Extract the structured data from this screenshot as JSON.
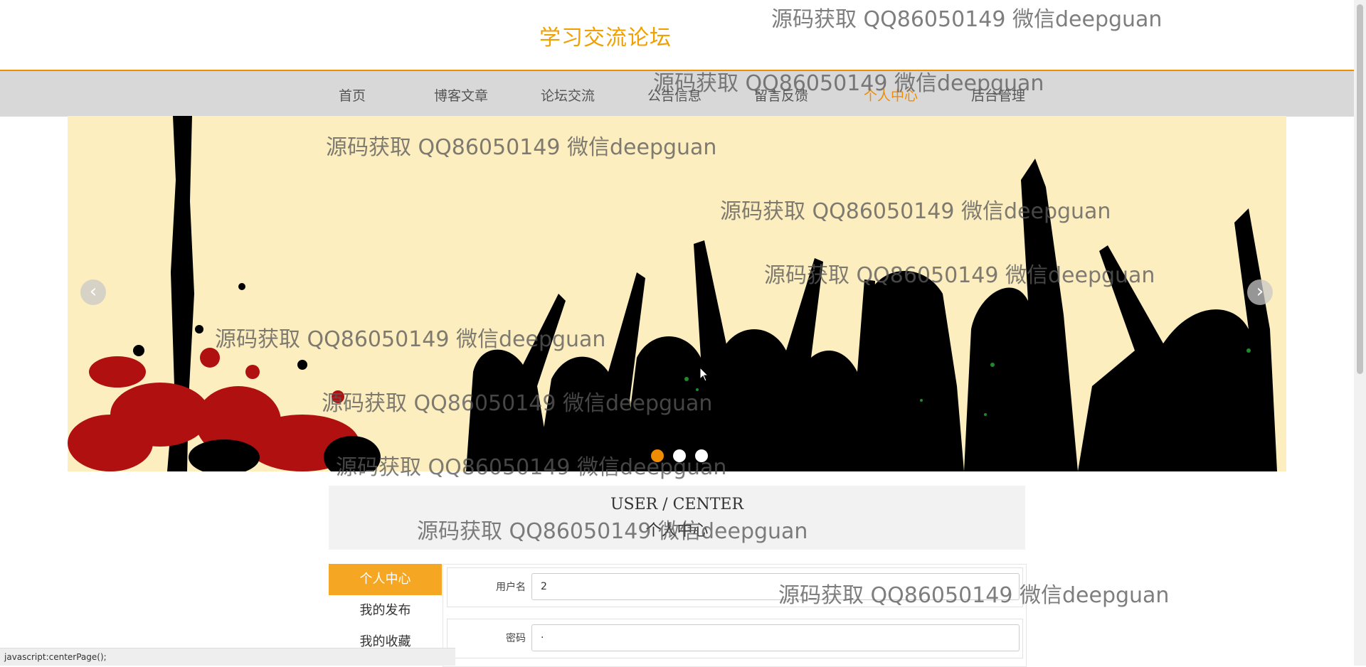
{
  "site_title": "学习交流论坛",
  "nav": {
    "items": [
      "首页",
      "博客文章",
      "论坛交流",
      "公告信息",
      "留言反馈",
      "个人中心",
      "后台管理"
    ],
    "active": "个人中心"
  },
  "banner": {
    "prev_icon": "chevron-left-icon",
    "next_icon": "chevron-right-icon",
    "prev_glyph": "‹",
    "next_glyph": "›",
    "slide_count": 3,
    "active_slide": 1
  },
  "section": {
    "title_en": "USER / CENTER",
    "title_cn": "个人中心"
  },
  "side_menu": {
    "items": [
      "个人中心",
      "我的发布",
      "我的收藏"
    ],
    "active": "个人中心"
  },
  "form": {
    "username_label": "用户名",
    "username_value": "2",
    "password_label": "密码",
    "password_value": "·"
  },
  "watermark_text": "源码获取 QQ86050149 微信deepguan",
  "status_bar": "javascript:centerPage();",
  "colors": {
    "accent": "#f08c00",
    "menu_active": "#f5a623",
    "nav_bg": "#d8d8d8",
    "banner_bg": "#fdeebf"
  }
}
